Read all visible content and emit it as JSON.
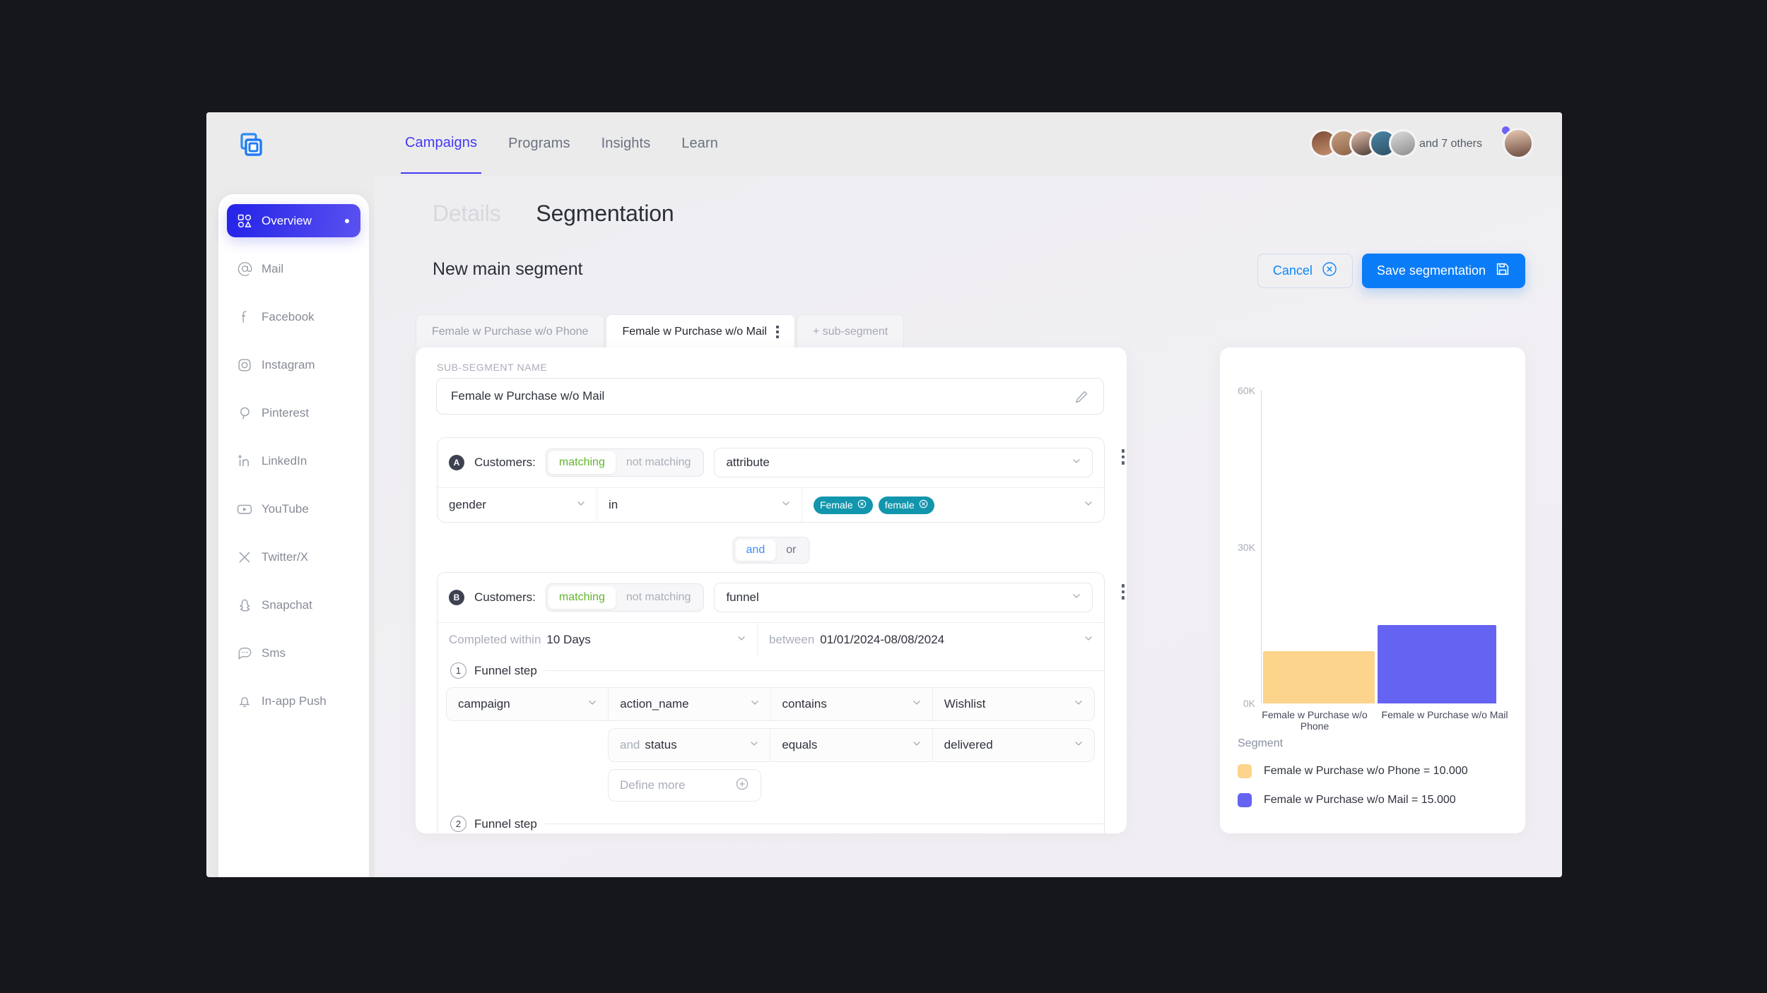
{
  "brand": {
    "logo_icon": "copy-layers-icon",
    "accent": "#1f7bf6"
  },
  "topnav": {
    "items": [
      {
        "label": "Campaigns",
        "active": true
      },
      {
        "label": "Programs",
        "active": false
      },
      {
        "label": "Insights",
        "active": false
      },
      {
        "label": "Learn",
        "active": false
      }
    ],
    "others_text": "and 7 others"
  },
  "sidebar": {
    "items": [
      {
        "label": "Overview",
        "icon": "grid-shapes-icon",
        "active": true
      },
      {
        "label": "Mail",
        "icon": "at-sign-icon",
        "active": false
      },
      {
        "label": "Facebook",
        "icon": "facebook-icon",
        "active": false
      },
      {
        "label": "Instagram",
        "icon": "instagram-icon",
        "active": false
      },
      {
        "label": "Pinterest",
        "icon": "pinterest-icon",
        "active": false
      },
      {
        "label": "LinkedIn",
        "icon": "linkedin-icon",
        "active": false
      },
      {
        "label": "YouTube",
        "icon": "youtube-icon",
        "active": false
      },
      {
        "label": "Twitter/X",
        "icon": "twitter-x-icon",
        "active": false
      },
      {
        "label": "Snapchat",
        "icon": "snapchat-icon",
        "active": false
      },
      {
        "label": "Sms",
        "icon": "chat-bubble-icon",
        "active": false
      },
      {
        "label": "In-app Push",
        "icon": "bell-icon",
        "active": false
      }
    ],
    "collapse_icon": "double-chevron-left-icon"
  },
  "page": {
    "tabs": [
      {
        "label": "Details",
        "active": false
      },
      {
        "label": "Segmentation",
        "active": true
      }
    ],
    "title": "New main segment",
    "cancel_label": "Cancel",
    "cancel_icon": "circle-x-icon",
    "save_label": "Save segmentation",
    "save_icon": "save-disk-icon"
  },
  "segment_tabs": [
    {
      "label": "Female w Purchase w/o Phone",
      "active": false,
      "has_menu": false
    },
    {
      "label": "Female w Purchase w/o Mail",
      "active": true,
      "has_menu": true
    },
    {
      "label": "+ sub-segment",
      "active": false,
      "has_menu": false
    }
  ],
  "builder": {
    "name_field_label": "SUB-SEGMENT NAME",
    "name_value": "Female w Purchase w/o Mail",
    "edit_icon": "pencil-icon",
    "condition_a": {
      "letter": "A",
      "subject_label": "Customers:",
      "match_on": "matching",
      "match_off": "not matching",
      "type_value": "attribute",
      "field_value": "gender",
      "operator_value": "in",
      "tags": [
        "Female",
        "female"
      ]
    },
    "joiner": {
      "on": "and",
      "off": "or"
    },
    "condition_b": {
      "letter": "B",
      "subject_label": "Customers:",
      "match_on": "matching",
      "match_off": "not matching",
      "type_value": "funnel",
      "completed_prefix": "Completed within",
      "completed_value": "10 Days",
      "between_prefix": "between",
      "between_value": "01/01/2024-08/08/2024",
      "steps": [
        {
          "num": "1",
          "label": "Funnel step",
          "row1": [
            "campaign",
            "action_name",
            "contains",
            "Wishlist"
          ],
          "row2_prefix": "and",
          "row2": [
            "status",
            "equals",
            "delivered"
          ],
          "define_more": "Define more",
          "define_more_icon": "plus-circle-icon"
        },
        {
          "num": "2",
          "label": "Funnel step"
        }
      ]
    }
  },
  "chart_data": {
    "type": "bar",
    "title": "",
    "categories": [
      "Female w Purchase w/o Phone",
      "Female w Purchase w/o Mail"
    ],
    "values": [
      10000,
      15000
    ],
    "colors": [
      "#fcd48b",
      "#6563f2"
    ],
    "ylabel": "",
    "xlabel": "",
    "ylim": [
      0,
      60000
    ],
    "yticks": [
      0,
      30000,
      60000
    ],
    "ytick_labels": [
      "0K",
      "30K",
      "60K"
    ],
    "grid": false,
    "legend_position": "below",
    "legend_title": "Segment",
    "legend": [
      {
        "label": "Female w Purchase w/o Phone = 10.000",
        "color": "#fcd48b"
      },
      {
        "label": "Female w Purchase w/o Mail = 15.000",
        "color": "#6563f2"
      }
    ]
  }
}
